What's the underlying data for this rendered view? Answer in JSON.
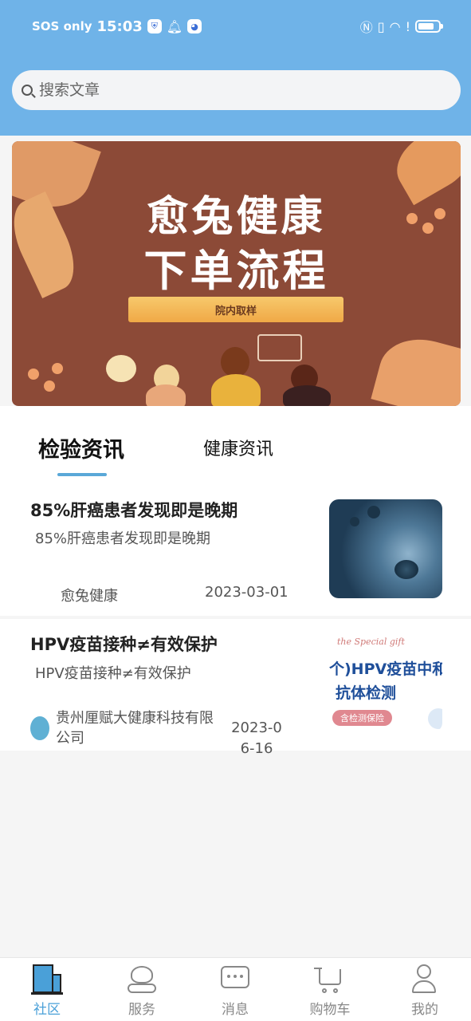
{
  "status_bar": {
    "network": "SOS only",
    "time": "15:03",
    "battery_level": 0.8
  },
  "search": {
    "placeholder": "搜索文章"
  },
  "banner": {
    "title_line1": "愈兔健康",
    "title_line2": "下单流程",
    "tag": "院内取样"
  },
  "tabs": [
    {
      "label": "检验资讯",
      "active": true
    },
    {
      "label": "健康资讯",
      "active": false
    }
  ],
  "articles": [
    {
      "title": "85%肝癌患者发现即是晚期",
      "summary": "85%肝癌患者发现即是晚期",
      "author": "愈兔健康",
      "date": "2023-03-01"
    },
    {
      "title": "HPV疫苗接种≠有效保护",
      "summary": "HPV疫苗接种≠有效保护",
      "author": "贵州厘赋大健康科技有限公司",
      "date": "2023-06-16",
      "thumb_text": {
        "gift": "the Special gift",
        "line1": "个)HPV疫苗中和",
        "line2": "抗体检测",
        "badge": "含检测保险"
      }
    }
  ],
  "bottom_nav": [
    {
      "label": "社区",
      "icon": "community-building-icon",
      "active": true
    },
    {
      "label": "服务",
      "icon": "heart-hands-icon",
      "active": false
    },
    {
      "label": "消息",
      "icon": "chat-bubble-icon",
      "active": false
    },
    {
      "label": "购物车",
      "icon": "cart-icon",
      "active": false
    },
    {
      "label": "我的",
      "icon": "user-icon",
      "active": false
    }
  ],
  "colors": {
    "header": "#6fb3e8",
    "accent": "#4aa0d8",
    "banner_bg": "#8c4a37"
  }
}
